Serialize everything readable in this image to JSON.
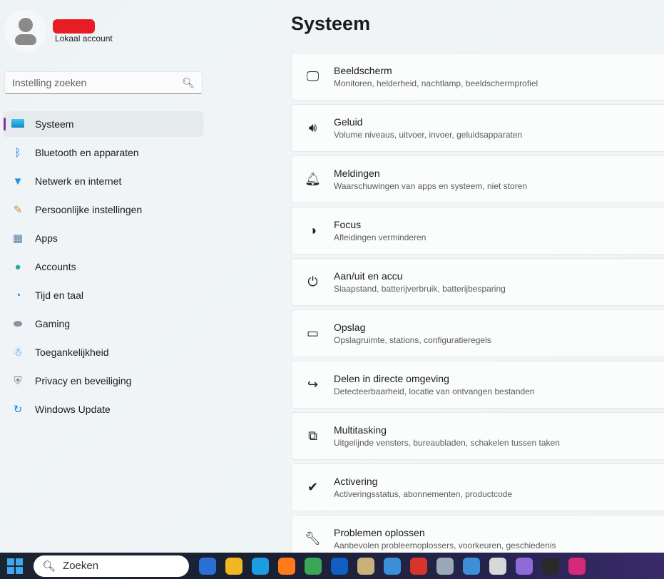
{
  "account": {
    "type": "Lokaal account"
  },
  "search": {
    "placeholder": "Instelling zoeken"
  },
  "nav": [
    {
      "label": "Systeem",
      "icon": "monitor-icon",
      "selected": true
    },
    {
      "label": "Bluetooth en apparaten",
      "icon": "bluetooth-icon"
    },
    {
      "label": "Netwerk en internet",
      "icon": "wifi-icon"
    },
    {
      "label": "Persoonlijke instellingen",
      "icon": "brush-icon"
    },
    {
      "label": "Apps",
      "icon": "apps-icon"
    },
    {
      "label": "Accounts",
      "icon": "person-icon"
    },
    {
      "label": "Tijd en taal",
      "icon": "globe-clock-icon"
    },
    {
      "label": "Gaming",
      "icon": "gamepad-icon"
    },
    {
      "label": "Toegankelijkheid",
      "icon": "accessibility-icon"
    },
    {
      "label": "Privacy en beveiliging",
      "icon": "shield-icon"
    },
    {
      "label": "Windows Update",
      "icon": "update-icon"
    }
  ],
  "main": {
    "title": "Systeem",
    "cards": [
      {
        "title": "Beeldscherm",
        "subtitle": "Monitoren, helderheid, nachtlamp, beeldschermprofiel",
        "icon": "laptop-icon"
      },
      {
        "title": "Geluid",
        "subtitle": "Volume niveaus, uitvoer, invoer, geluidsapparaten",
        "icon": "speaker-icon"
      },
      {
        "title": "Meldingen",
        "subtitle": "Waarschuwingen van apps en systeem, niet storen",
        "icon": "bell-icon"
      },
      {
        "title": "Focus",
        "subtitle": "Afleidingen verminderen",
        "icon": "focus-icon"
      },
      {
        "title": "Aan/uit en accu",
        "subtitle": "Slaapstand, batterijverbruik, batterijbesparing",
        "icon": "power-icon"
      },
      {
        "title": "Opslag",
        "subtitle": "Opslagruimte, stations, configuratieregels",
        "icon": "storage-icon"
      },
      {
        "title": "Delen in directe omgeving",
        "subtitle": "Detecteerbaarheid, locatie van ontvangen bestanden",
        "icon": "share-icon"
      },
      {
        "title": "Multitasking",
        "subtitle": "Uitgelijnde vensters, bureaubladen, schakelen tussen taken",
        "icon": "multitasking-icon"
      },
      {
        "title": "Activering",
        "subtitle": "Activeringsstatus, abonnementen, productcode",
        "icon": "check-circle-icon"
      },
      {
        "title": "Problemen oplossen",
        "subtitle": "Aanbevolen probleemoplossers, voorkeuren, geschiedenis",
        "icon": "wrench-icon"
      }
    ]
  },
  "taskbar": {
    "search_label": "Zoeken",
    "apps": [
      {
        "name": "thunderbird-icon",
        "color": "#2a6fd6"
      },
      {
        "name": "file-explorer-icon",
        "color": "#f2b824"
      },
      {
        "name": "edge-icon",
        "color": "#1b9de2"
      },
      {
        "name": "firefox-icon",
        "color": "#ff7a1a"
      },
      {
        "name": "chrome-icon",
        "color": "#3aa757"
      },
      {
        "name": "teamviewer-icon",
        "color": "#0e5ec4"
      },
      {
        "name": "app-icon",
        "color": "#c9b27a"
      },
      {
        "name": "paint-icon",
        "color": "#3c8ed8"
      },
      {
        "name": "ccleaner-icon",
        "color": "#d9342b"
      },
      {
        "name": "app-icon",
        "color": "#9aa8b8"
      },
      {
        "name": "app-icon",
        "color": "#3d8fd8"
      },
      {
        "name": "app-icon",
        "color": "#d8d8d8"
      },
      {
        "name": "app-icon",
        "color": "#8e6ad8"
      },
      {
        "name": "app-icon",
        "color": "#2a2a2a"
      },
      {
        "name": "instagram-icon",
        "color": "#d6297a"
      }
    ]
  }
}
